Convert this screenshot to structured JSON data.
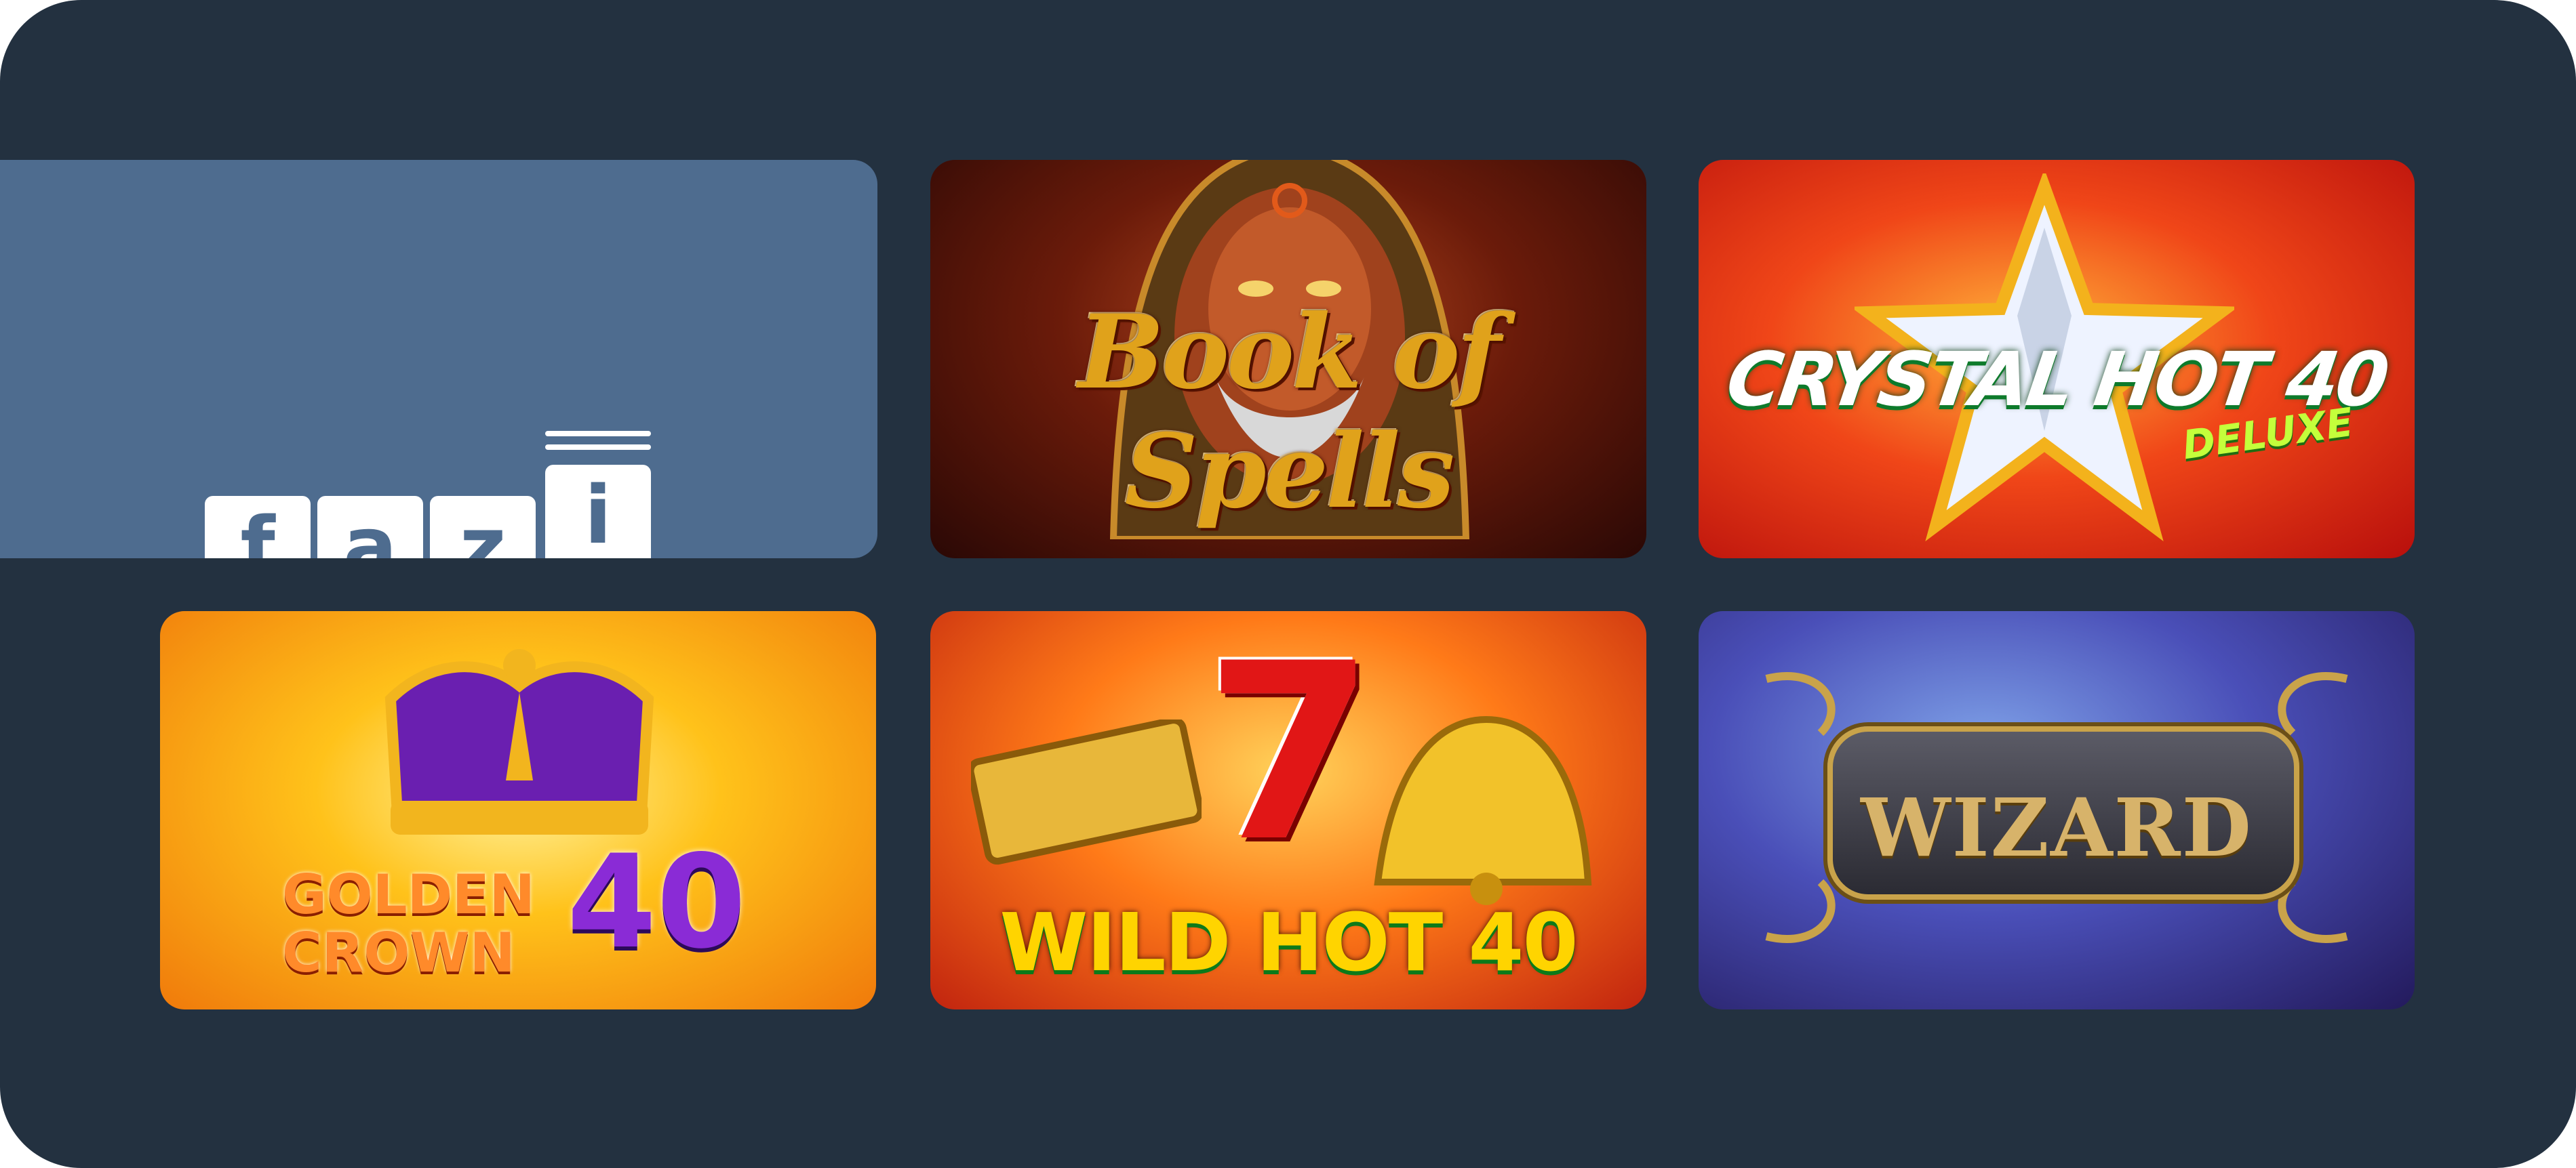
{
  "provider": {
    "logo_letters": [
      "f",
      "a",
      "z",
      "i"
    ],
    "logo_name": "fazi"
  },
  "games": [
    {
      "title": "Book of Spells"
    },
    {
      "title": "CRYSTAL HOT 40",
      "subtitle": "DELUXE"
    },
    {
      "title_line1": "GOLDEN",
      "title_line2": "CROWN",
      "number": "40"
    },
    {
      "title": "WILD HOT 40",
      "symbol": "7"
    },
    {
      "title": "WIZARD"
    }
  ],
  "colors": {
    "panel": "#233140",
    "provider_tile": "#4e6c8f",
    "logo": "#ffffff"
  },
  "icons": [
    "fazi-logo-icon",
    "wizard-hood-icon",
    "star-icon",
    "crown-icon",
    "seven-icon",
    "ornament-frame-icon"
  ]
}
